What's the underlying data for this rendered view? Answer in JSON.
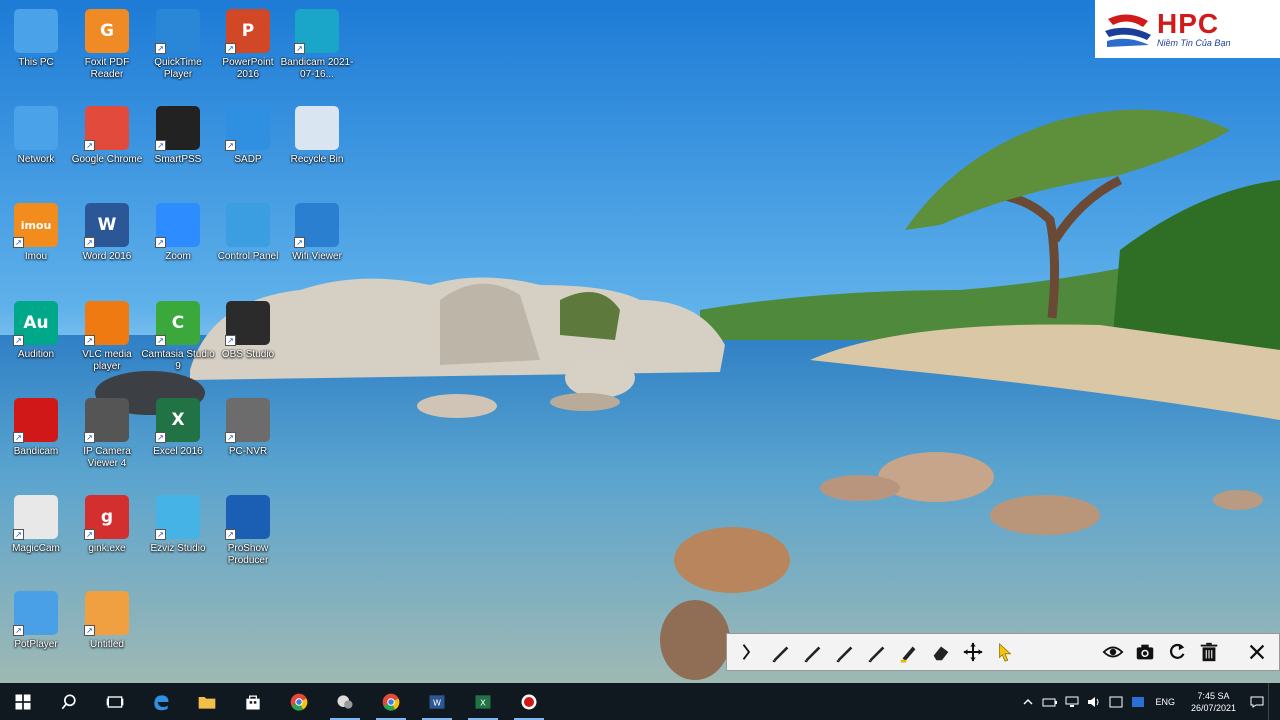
{
  "desktop": {
    "icons": [
      {
        "label": "This PC",
        "icon": "computer-icon",
        "color": "#4aa3e8"
      },
      {
        "label": "Foxit PDF Reader",
        "icon": "foxit-pdf-icon",
        "color": "#f08a24"
      },
      {
        "label": "QuickTime Player",
        "icon": "quicktime-icon",
        "color": "#2a86d6"
      },
      {
        "label": "PowerPoint 2016",
        "icon": "powerpoint-icon",
        "color": "#d24726"
      },
      {
        "label": "Bandicam 2021-07-16...",
        "icon": "video-file-icon",
        "color": "#1aa6c8"
      },
      {
        "label": "Network",
        "icon": "network-icon",
        "color": "#4aa3e8"
      },
      {
        "label": "Google Chrome",
        "icon": "chrome-icon",
        "color": "#e24a3b"
      },
      {
        "label": "SmartPSS",
        "icon": "smartpss-icon",
        "color": "#222222"
      },
      {
        "label": "SADP",
        "icon": "sadp-icon",
        "color": "#2f8fe0"
      },
      {
        "label": "Recycle Bin",
        "icon": "recycle-bin-icon",
        "color": "#d9e6f2"
      },
      {
        "label": "Imou",
        "icon": "imou-icon",
        "color": "#f28c1c"
      },
      {
        "label": "Word 2016",
        "icon": "word-icon",
        "color": "#2b5797"
      },
      {
        "label": "Zoom",
        "icon": "zoom-icon",
        "color": "#2d8cff"
      },
      {
        "label": "Control Panel",
        "icon": "control-panel-icon",
        "color": "#3b9ee0"
      },
      {
        "label": "Wifi Viewer",
        "icon": "network-viewer-icon",
        "color": "#2a7fd1"
      },
      {
        "label": "Audition",
        "icon": "audition-icon",
        "color": "#00a88a"
      },
      {
        "label": "VLC media player",
        "icon": "vlc-icon",
        "color": "#f07a12"
      },
      {
        "label": "Camtasia Studio 9",
        "icon": "camtasia-icon",
        "color": "#3aa83a"
      },
      {
        "label": "OBS Studio",
        "icon": "obs-icon",
        "color": "#2b2b2b"
      },
      {
        "label": "Bandicam",
        "icon": "bandicam-icon",
        "color": "#d01818"
      },
      {
        "label": "IP Camera Viewer 4",
        "icon": "camera-viewer-icon",
        "color": "#555555"
      },
      {
        "label": "Excel 2016",
        "icon": "excel-icon",
        "color": "#217346"
      },
      {
        "label": "PC-NVR",
        "icon": "pc-nvr-icon",
        "color": "#6c6c6c"
      },
      {
        "label": "MagicCam",
        "icon": "magiccam-icon",
        "color": "#e8e8e8"
      },
      {
        "label": "gink.exe",
        "icon": "gink-icon",
        "color": "#d32f2f"
      },
      {
        "label": "Ezviz Studio",
        "icon": "ezviz-icon",
        "color": "#46b3e6"
      },
      {
        "label": "ProShow Producer",
        "icon": "proshow-icon",
        "color": "#1a5fb4"
      },
      {
        "label": "PotPlayer",
        "icon": "potplayer-icon",
        "color": "#4aa0e6"
      },
      {
        "label": "Untitled",
        "icon": "document-icon",
        "color": "#f0a040"
      }
    ]
  },
  "logo": {
    "brand": "HPC",
    "slogan": "Niềm Tin Của Bạn"
  },
  "pen_toolbar": {
    "tools": [
      {
        "name": "collapse-toolbar-button",
        "icon": "chevron-right-icon"
      },
      {
        "name": "pen-1-button",
        "icon": "pen-icon"
      },
      {
        "name": "pen-2-button",
        "icon": "pen-icon"
      },
      {
        "name": "pen-3-button",
        "icon": "pen-icon"
      },
      {
        "name": "pen-4-button",
        "icon": "pen-icon"
      },
      {
        "name": "highlighter-button",
        "icon": "highlighter-icon"
      },
      {
        "name": "eraser-button",
        "icon": "eraser-icon"
      },
      {
        "name": "move-button",
        "icon": "move-icon"
      },
      {
        "name": "pointer-button",
        "icon": "cursor-icon"
      },
      {
        "name": "visibility-button",
        "icon": "eye-icon"
      },
      {
        "name": "screenshot-button",
        "icon": "camera-icon"
      },
      {
        "name": "undo-button",
        "icon": "undo-icon"
      },
      {
        "name": "clear-button",
        "icon": "trash-icon"
      },
      {
        "name": "close-button",
        "icon": "close-icon"
      }
    ]
  },
  "taskbar": {
    "apps": [
      {
        "name": "start-button",
        "icon": "windows-icon"
      },
      {
        "name": "search-button",
        "icon": "search-icon"
      },
      {
        "name": "task-view-button",
        "icon": "task-view-icon"
      },
      {
        "name": "edge-taskbar",
        "icon": "edge-icon"
      },
      {
        "name": "file-explorer-taskbar",
        "icon": "folder-icon"
      },
      {
        "name": "store-taskbar",
        "icon": "store-icon"
      },
      {
        "name": "chrome-taskbar",
        "icon": "chrome-icon"
      },
      {
        "name": "magiccam-taskbar",
        "icon": "magiccam-icon"
      },
      {
        "name": "chrome-2-taskbar",
        "icon": "chrome-icon"
      },
      {
        "name": "word-taskbar",
        "icon": "word-icon"
      },
      {
        "name": "excel-taskbar",
        "icon": "excel-icon"
      },
      {
        "name": "bandicam-taskbar",
        "icon": "bandicam-icon"
      }
    ],
    "tray": {
      "language": "ENG",
      "time": "7:45 SA",
      "date": "26/07/2021"
    }
  }
}
